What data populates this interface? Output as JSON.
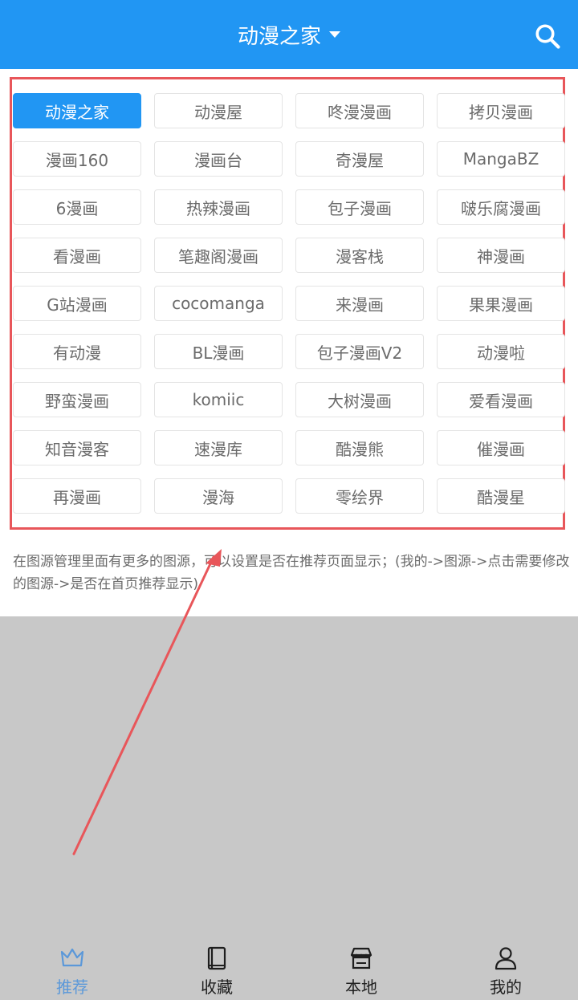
{
  "header": {
    "title": "动漫之家"
  },
  "sources": [
    {
      "label": "动漫之家",
      "active": true
    },
    {
      "label": "动漫屋"
    },
    {
      "label": "咚漫漫画"
    },
    {
      "label": "拷贝漫画"
    },
    {
      "label": "漫画160"
    },
    {
      "label": "漫画台"
    },
    {
      "label": "奇漫屋"
    },
    {
      "label": "MangaBZ"
    },
    {
      "label": "6漫画"
    },
    {
      "label": "热辣漫画"
    },
    {
      "label": "包子漫画"
    },
    {
      "label": "啵乐腐漫画"
    },
    {
      "label": "看漫画"
    },
    {
      "label": "笔趣阁漫画"
    },
    {
      "label": "漫客栈"
    },
    {
      "label": "神漫画"
    },
    {
      "label": "G站漫画"
    },
    {
      "label": "cocomanga"
    },
    {
      "label": "来漫画"
    },
    {
      "label": "果果漫画"
    },
    {
      "label": "有动漫"
    },
    {
      "label": "BL漫画"
    },
    {
      "label": "包子漫画V2"
    },
    {
      "label": "动漫啦"
    },
    {
      "label": "野蛮漫画"
    },
    {
      "label": "komiic"
    },
    {
      "label": "大树漫画"
    },
    {
      "label": "爱看漫画"
    },
    {
      "label": "知音漫客"
    },
    {
      "label": "速漫库"
    },
    {
      "label": "酷漫熊"
    },
    {
      "label": "催漫画"
    },
    {
      "label": "再漫画"
    },
    {
      "label": "漫海"
    },
    {
      "label": "零绘界"
    },
    {
      "label": "酷漫星"
    }
  ],
  "note": "在图源管理里面有更多的图源，可以设置是否在推荐页面显示；(我的->图源->点击需要修改的图源->是否在首页推荐显示)",
  "tabs": [
    {
      "label": "推荐",
      "icon": "crown-icon",
      "active": true
    },
    {
      "label": "收藏",
      "icon": "book-icon"
    },
    {
      "label": "本地",
      "icon": "store-icon"
    },
    {
      "label": "我的",
      "icon": "user-icon"
    }
  ],
  "colors": {
    "accent": "#2196F3",
    "annotation": "#e8565a",
    "tab_active": "#5b98d9"
  }
}
